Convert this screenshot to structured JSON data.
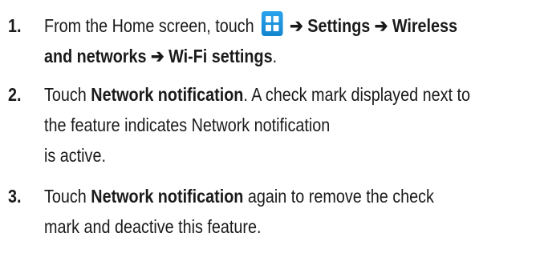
{
  "steps": [
    {
      "number": "1.",
      "line1_pre": "From the Home screen, touch",
      "line1_arrow1": "➔",
      "line1_bold1": "Settings",
      "line1_arrow2": "➔",
      "line1_bold2": "Wireless",
      "line2_bold1": "and networks",
      "line2_arrow": "➔",
      "line2_bold2": "Wi-Fi settings",
      "line2_post": ".",
      "icon": "applications-grid-icon"
    },
    {
      "number": "2.",
      "line1_pre": "Touch",
      "line1_bold": "Network notification",
      "line1_post": ". A check mark displayed next to",
      "line2": "the feature indicates Network notification",
      "line3": "is active."
    },
    {
      "number": "3.",
      "line1_pre": "Touch",
      "line1_bold": "Network notification",
      "line1_post": "again to remove the check",
      "line2": "mark and deactive this feature."
    }
  ],
  "colors": {
    "text": "#1a1a1a",
    "icon_blue": "#1a93df"
  }
}
